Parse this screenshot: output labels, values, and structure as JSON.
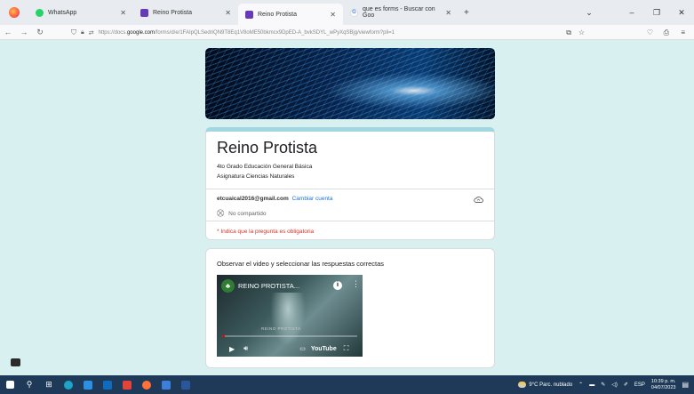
{
  "browser": {
    "tabs": [
      {
        "label": "WhatsApp",
        "icon": "whatsapp-icon"
      },
      {
        "label": "Reino Protista",
        "icon": "forms-icon"
      },
      {
        "label": "Reino Protista",
        "icon": "forms-icon"
      },
      {
        "label": "que es forms - Buscar con Goo",
        "icon": "google-icon"
      }
    ],
    "new_tab": "+",
    "url_prefix": "https://docs.",
    "url_host": "google.com",
    "url_rest": "/forms/d/e/1FAIpQLSedriQN9T8Eq1V8oME50bkmcx9DpED-A_bvkSDYL_wPyXqSBjg/viewform?pli=1"
  },
  "form": {
    "title": "Reino Protista",
    "description_line1": "4to Grado Educación General Básica",
    "description_line2": "Asignatura Ciencias Naturales",
    "account_email": "etcuaical2016@gmail.com",
    "switch_account": "Cambiar cuenta",
    "not_shared": "No compartido",
    "required_note": "* Indica que la pregunta es obligatoria",
    "question": "Observar el video y seleccionar las respuestas correctas",
    "video": {
      "title": "REINO PROTISTA...",
      "caption": "REINO PROTISTA",
      "brand": "YouTube",
      "progress": 0.02
    }
  },
  "taskbar": {
    "weather": "9°C Parc. nublado",
    "language": "ESP",
    "time": "10:39 p. m.",
    "date": "04/07/2023"
  },
  "colors": {
    "page_bg": "#d8f0f0",
    "accent": "#a1d7e0",
    "link": "#1a73e8",
    "required": "#d93025"
  }
}
